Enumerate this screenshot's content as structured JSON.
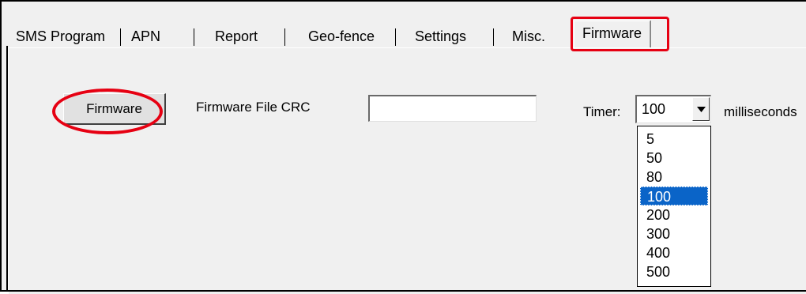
{
  "tabs": [
    {
      "label": "SMS Program"
    },
    {
      "label": "APN"
    },
    {
      "label": "Report"
    },
    {
      "label": "Geo-fence"
    },
    {
      "label": "Settings"
    },
    {
      "label": "Misc."
    },
    {
      "label": "Firmware",
      "active": true
    }
  ],
  "panel": {
    "firmware_button_label": "Firmware",
    "crc_label": "Firmware File CRC",
    "crc_value": "",
    "timer_label": "Timer:",
    "timer_value": "100",
    "units_label": "milliseconds",
    "timer_options": [
      "5",
      "50",
      "80",
      "100",
      "200",
      "300",
      "400",
      "500"
    ],
    "timer_selected": "100"
  },
  "colors": {
    "highlight": "#e60012",
    "selection": "#0a64c8",
    "background": "#f0f0f0"
  },
  "icons": {
    "combo_arrow": "triangle-down-icon"
  }
}
